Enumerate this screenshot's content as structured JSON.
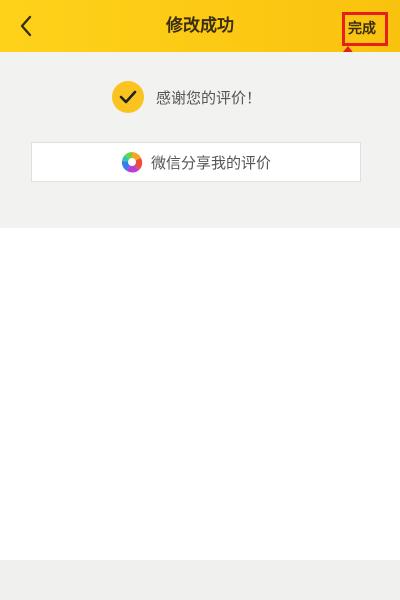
{
  "header": {
    "title": "修改成功",
    "done_label": "完成",
    "back_icon": "chevron-left-icon"
  },
  "result": {
    "message": "感谢您的评价！",
    "icon": "check-icon"
  },
  "share": {
    "label": "微信分享我的评价",
    "icon": "wechat-moments-icon"
  },
  "colors": {
    "header_bg": "#f9c20e",
    "check_bg": "#fbc31f",
    "highlight": "#e61e1e"
  }
}
